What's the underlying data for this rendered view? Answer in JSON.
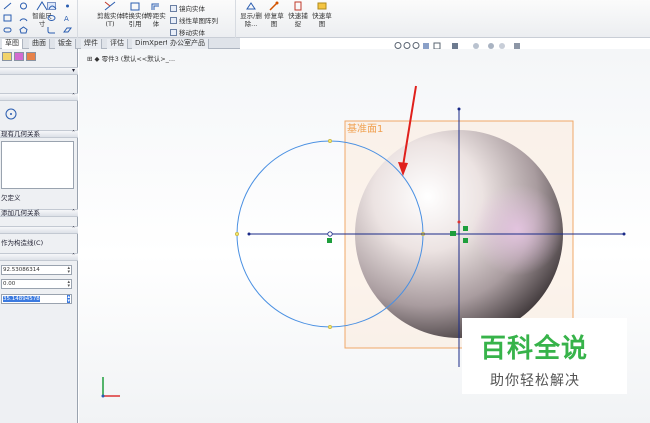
{
  "ribbon": {
    "smart_dimension": "智能尺寸",
    "trim_entities": "剪裁实体(T)",
    "convert_entities": "转换实体引用",
    "offset_entities": "等距实体",
    "mirror_entities": "镜向实体",
    "linear_pattern": "线性草图阵列",
    "move_entities": "移动实体",
    "display_delete_relations": "显示/删除...",
    "repair_sketch": "修复草图",
    "quick_snaps": "快速捕捉",
    "rapid_sketch": "快速草图"
  },
  "tabs": [
    "草图",
    "曲面",
    "钣金",
    "焊件",
    "评估",
    "DimXpert",
    "办公室产品"
  ],
  "active_tab": 0,
  "hud_icons": [
    "zoom-fit-icon",
    "zoom-area-icon",
    "previous-view-icon",
    "section-view-icon",
    "view-orientation-icon",
    "display-style-icon",
    "hide-show-icon",
    "appearance-icon",
    "scene-icon",
    "view-settings-icon"
  ],
  "feature_tree": {
    "label": "零件3  (默认<<默认>_..."
  },
  "left_panel": {
    "section_existing_relations": "现有几何关系",
    "full_defined_label": "欠定义",
    "section_add_relations": "添加几何关系",
    "options_label": "作为构造线(C)",
    "params": [
      "92.53086314",
      "0.00",
      "35.14894578"
    ]
  },
  "viewport": {
    "plane_label": "基准面1"
  },
  "watermark": {
    "title": "百科全说",
    "subtitle": "助你轻松解决"
  },
  "colors": {
    "sketch_blue": "#4a90e2",
    "plane_orange": "#f0a868",
    "selection_green": "#1e9e3c",
    "watermark_green": "#37b34a"
  }
}
